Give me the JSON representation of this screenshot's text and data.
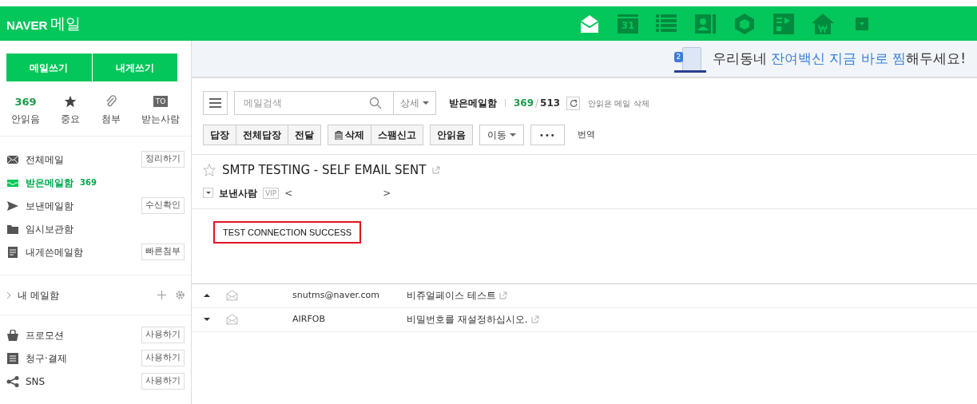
{
  "header": {
    "brand": "NAVER",
    "title": "메일",
    "apps": [
      {
        "kind": "mail",
        "selected": true
      },
      {
        "kind": "calendar",
        "label": "31",
        "selected": false
      },
      {
        "kind": "list",
        "selected": false
      },
      {
        "kind": "contacts",
        "selected": false
      },
      {
        "kind": "box",
        "selected": false
      },
      {
        "kind": "memo",
        "selected": false
      },
      {
        "kind": "house",
        "selected": false
      },
      {
        "kind": "more",
        "selected": false
      }
    ]
  },
  "sidebar": {
    "compose_buttons": [
      "메일쓰기",
      "내게쓰기"
    ],
    "quick_filters": [
      {
        "kind": "count",
        "value": "369",
        "label": "안읽음"
      },
      {
        "kind": "star",
        "label": "중요"
      },
      {
        "kind": "clip",
        "label": "첨부"
      },
      {
        "kind": "to",
        "value": "TO",
        "label": "받는사람"
      }
    ],
    "folders": [
      {
        "label": "전체메일",
        "action": "정리하기",
        "selected": false
      },
      {
        "label": "받은메일함",
        "count": "369",
        "selected": true
      },
      {
        "label": "보낸메일함",
        "action": "수신확인",
        "selected": false
      },
      {
        "label": "임시보관함",
        "selected": false
      },
      {
        "label": "내게쓴메일함",
        "action": "빠른첨부",
        "selected": false
      }
    ],
    "my_folders": {
      "label": "내 메일함",
      "expanded": false
    },
    "services": [
      {
        "label": "프로모션",
        "action": "사용하기"
      },
      {
        "label": "청구·결제",
        "action": "사용하기"
      },
      {
        "label": "SNS",
        "action": "사용하기"
      }
    ]
  },
  "banner": {
    "before": "우리동네 ",
    "highlight": "잔여백신 지금 바로 찜",
    "after": "해두세요!",
    "badge": "2"
  },
  "toolbar": {
    "search_placeholder": "메일검색",
    "detail": "상세",
    "folder": "받은메일함",
    "unread": "369",
    "separator": "/",
    "total": "513",
    "delete_unread": "안읽은 메일 삭제",
    "actions": [
      {
        "kind": "group",
        "items": [
          "답장",
          "전체답장",
          "전달"
        ]
      },
      {
        "kind": "group",
        "trash": true,
        "items": [
          "삭제",
          "스팸신고"
        ]
      },
      {
        "kind": "group",
        "items": [
          "안읽음"
        ]
      },
      {
        "kind": "dropdown",
        "items": [
          "이동"
        ]
      },
      {
        "kind": "more",
        "items": [
          "•••"
        ]
      },
      {
        "kind": "plain",
        "items": [
          "번역"
        ]
      }
    ]
  },
  "message": {
    "starred": false,
    "subject": "SMTP TESTING - SELF EMAIL SENT",
    "sender_label": "보낸사람",
    "vip": "VIP",
    "prev": "<",
    "next": ">",
    "body": "TEST CONNECTION SUCCESS"
  },
  "nearby": [
    {
      "from": "snutms@naver.com",
      "subject": "비쥬얼페이스 테스트"
    },
    {
      "from": "AIRFOB",
      "subject": "비밀번호를 재설정하십시오."
    }
  ]
}
